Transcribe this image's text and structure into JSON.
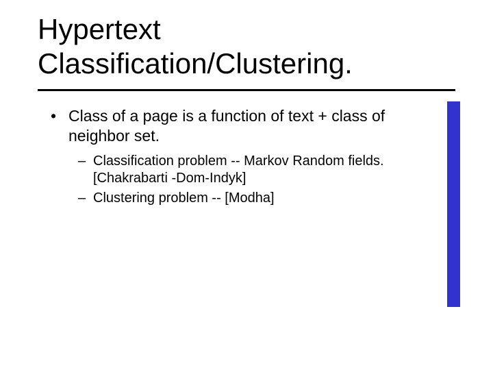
{
  "title": "Hypertext Classification/Clustering.",
  "bullets": {
    "item1": {
      "marker": "•",
      "text": "Class of a page is a function of text + class of neighbor set."
    },
    "sub": {
      "s1": {
        "marker": "–",
        "text": "Classification problem -- Markov Random fields. [Chakrabarti -Dom-Indyk]"
      },
      "s2": {
        "marker": "–",
        "text": "Clustering problem -- [Modha]"
      }
    }
  },
  "colors": {
    "accent": "#3232cf"
  }
}
